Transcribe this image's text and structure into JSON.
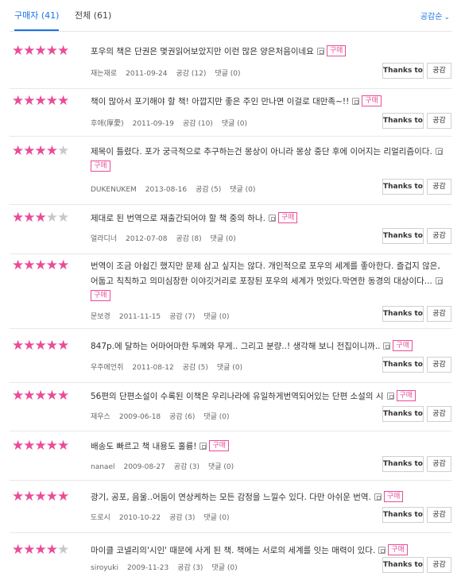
{
  "tabs": {
    "buyer": "구매자 (41)",
    "all": "전체 (61)",
    "sort": "공감순"
  },
  "icons": {
    "star": "star-icon",
    "quote": "quote-icon",
    "chevron": "chevron-down-icon"
  },
  "colors": {
    "accent": "#1a73e8",
    "star": "#ea4c98",
    "star_empty": "#c8c8c8"
  },
  "labels": {
    "buy_badge": "구매",
    "thanks": "Thanks to",
    "like": "공감"
  },
  "reviews": [
    {
      "rating": 5,
      "text": "포우의 책은 단권은 몇권읽어보았지만 이런 많은 양은처음이네요",
      "author": "재는재로",
      "date": "2011-09-24",
      "likes": "공감 (12)",
      "comments": "댓글 (0)"
    },
    {
      "rating": 5,
      "text": "책이 많아서 포기해야 할 책! 아깝지만 좋은 주인 만나면 이걸로 대만족~!!",
      "author": "후애(厚愛)",
      "date": "2011-09-19",
      "likes": "공감 (10)",
      "comments": "댓글 (0)"
    },
    {
      "rating": 4,
      "text": "제목이 틀렸다. 포가 궁극적으로 추구하는건 몽상이 아니라 몽상 중단 후에 이어지는 리얼리즘이다.",
      "author": "DUKENUKEM",
      "date": "2013-08-16",
      "likes": "공감 (5)",
      "comments": "댓글 (0)"
    },
    {
      "rating": 3,
      "text": "제대로 된 번역으로 재출간되어야 할 책 중의 하나.",
      "author": "얼라디너",
      "date": "2012-07-08",
      "likes": "공감 (8)",
      "comments": "댓글 (0)"
    },
    {
      "rating": 5,
      "text": "번역이 조금 아쉽긴 했지만 문제 삼고 싶지는 않다. 개인적으로 포우의 세계를 좋아한다. 즐겁지 않은, 어둡고 칙칙하고 의미심장한 이야깃거리로 포장된 포우의 세계가 멋있다.막연한 동경의 대상이다...",
      "author": "문보경",
      "date": "2011-11-15",
      "likes": "공감 (7)",
      "comments": "댓글 (0)"
    },
    {
      "rating": 5,
      "text": "847p.에 달하는 어마어마한 두께와 무게.. 그리고 분량..! 생각해 보니 전집이니까..",
      "author": "우주에언쥐",
      "date": "2011-08-12",
      "likes": "공감 (5)",
      "comments": "댓글 (0)"
    },
    {
      "rating": 5,
      "text": "56편의 단편소설이 수록된 이책은 우리나라에 유일하게번역되어있는 단편 소설의 시",
      "author": "재우스",
      "date": "2009-06-18",
      "likes": "공감 (6)",
      "comments": "댓글 (0)"
    },
    {
      "rating": 5,
      "text": "배송도 빠르고 책 내용도 훌륭!",
      "author": "nanael",
      "date": "2009-08-27",
      "likes": "공감 (3)",
      "comments": "댓글 (0)"
    },
    {
      "rating": 5,
      "text": "광기, 공포, 음울..어둠이 연상케하는 모든 감정을 느낄수 있다. 다만 아쉬운 번역.",
      "author": "도로시",
      "date": "2010-10-22",
      "likes": "공감 (3)",
      "comments": "댓글 (0)"
    },
    {
      "rating": 4,
      "text": "마이클 코넬리의'시인' 때문에 사게 된 책. 책에는 서로의 세계를 잇는 매력이 있다.",
      "author": "siroyuki",
      "date": "2009-11-23",
      "likes": "공감 (3)",
      "comments": "댓글 (0)"
    }
  ]
}
